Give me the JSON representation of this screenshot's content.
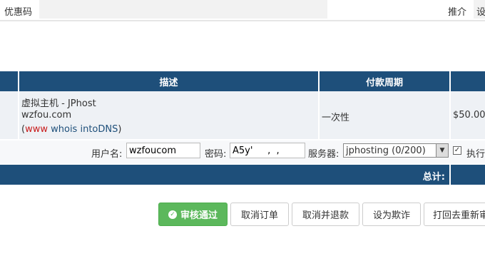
{
  "top": {
    "promo_label": "优惠码",
    "referral_label": "推介",
    "referral_value": "设"
  },
  "table": {
    "headers": [
      "",
      "描述",
      "付款周期",
      ""
    ],
    "item": {
      "name": "虚拟主机 - JPhost",
      "domain": "wzfou.com",
      "link_open": "(",
      "link_www": "www",
      "link_whois": "whois",
      "link_intodns": "intoDNS",
      "link_close": ")",
      "billing_cycle": "一次性",
      "amount": "$50.00"
    },
    "credentials": {
      "username_label": "用户名:",
      "username_value": "wzfoucom",
      "password_label": "密码:",
      "password_value": "A5y'     ,  ,",
      "server_label": "服务器:",
      "server_value": "jphosting (0/200)",
      "execute_label": "执行"
    },
    "total_label": "总计:"
  },
  "actions": {
    "approve": "审核通过",
    "cancel_order": "取消订单",
    "cancel_refund": "取消并退款",
    "set_fraud": "设为欺诈",
    "return_pending": "打回去重新审"
  },
  "colors": {
    "header_bg": "#1e4f7a",
    "approve_bg": "#5cb85c",
    "link_red": "#c81a1a"
  }
}
